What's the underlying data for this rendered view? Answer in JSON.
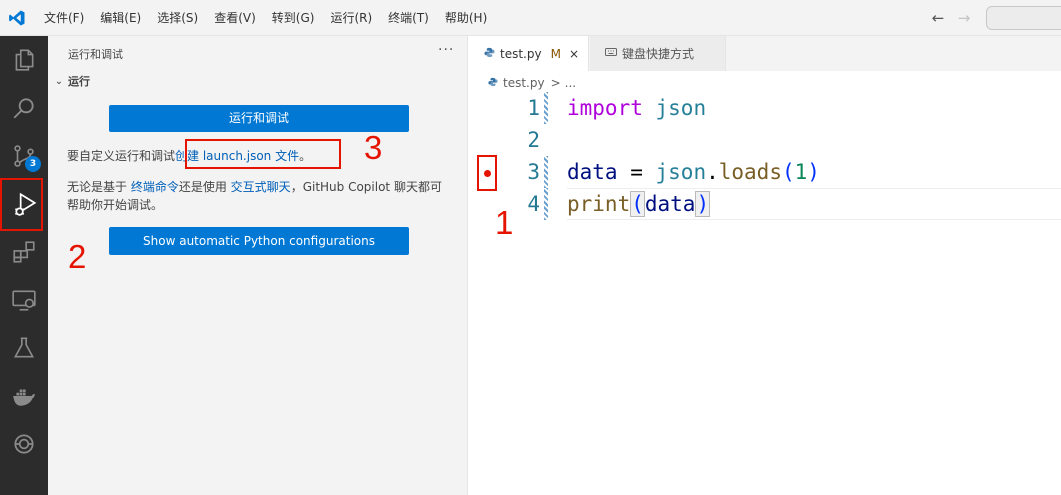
{
  "menu": [
    "文件(F)",
    "编辑(E)",
    "选择(S)",
    "查看(V)",
    "转到(G)",
    "运行(R)",
    "终端(T)",
    "帮助(H)"
  ],
  "nav": {
    "back": "←",
    "forward": "→"
  },
  "activity": {
    "scm_badge": "3"
  },
  "sidebar": {
    "title": "运行和调试",
    "more": "···",
    "section": "运行",
    "run_button": "运行和调试",
    "para1_prefix": "要自定义运行和调试",
    "para1_link": "创建 launch.json 文件",
    "para1_suffix": "。",
    "para2_a": "无论是基于 ",
    "para2_link1": "终端命令",
    "para2_b": "还是使用 ",
    "para2_link2": "交互式聊天",
    "para2_c": "，GitHub Copilot 聊天都可帮助你开始调试。",
    "python_button": "Show automatic Python configurations"
  },
  "editor": {
    "tabs": [
      {
        "name": "test.py",
        "modified": "M",
        "close": "×"
      },
      {
        "name": "键盘快捷方式"
      }
    ],
    "breadcrumb": {
      "file": "test.py",
      "sep": ">",
      "rest": "..."
    },
    "lines": [
      {
        "n": "1",
        "tokens": [
          {
            "t": "import",
            "c": "kw"
          },
          {
            "t": " "
          },
          {
            "t": "json",
            "c": "mod"
          }
        ]
      },
      {
        "n": "2",
        "tokens": []
      },
      {
        "n": "3",
        "tokens": [
          {
            "t": "data",
            "c": "var"
          },
          {
            "t": " = "
          },
          {
            "t": "json",
            "c": "mod"
          },
          {
            "t": "."
          },
          {
            "t": "loads",
            "c": "fn"
          },
          {
            "t": "(",
            "c": "paren"
          },
          {
            "t": "1",
            "c": "num"
          },
          {
            "t": ")",
            "c": "paren"
          }
        ]
      },
      {
        "n": "4",
        "tokens": [
          {
            "t": "print",
            "c": "fn"
          },
          {
            "t": "(",
            "c": "paren bracket-hl"
          },
          {
            "t": "data",
            "c": "var"
          },
          {
            "t": ")",
            "c": "paren bracket-hl"
          }
        ]
      }
    ]
  },
  "annotations": {
    "one": "1",
    "two": "2",
    "three": "3"
  },
  "colors": {
    "accent": "#0078d4",
    "annotation": "#e51400",
    "activity_bar": "#2c2c2c"
  }
}
